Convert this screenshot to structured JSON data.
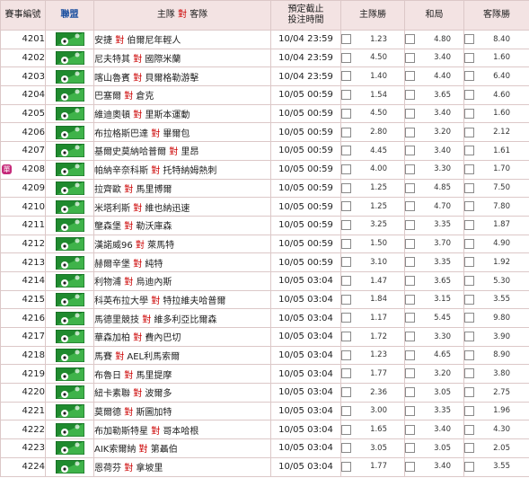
{
  "headers": {
    "num": "賽事編號",
    "league": "聯盟",
    "home": "主隊",
    "vs": "對",
    "away": "客隊",
    "time_line1": "預定截止",
    "time_line2": "投注時間",
    "home_win": "主隊勝",
    "draw": "和局",
    "away_win": "客隊勝"
  },
  "colors": {
    "header_bg": "#f3e3e3",
    "vs_red": "#cc0000",
    "league_blue": "#1a4fa0",
    "single_badge": "#c62a7a"
  },
  "rows": [
    {
      "num": "4201",
      "home": "安捷",
      "away": "伯爾尼年輕人",
      "time": "10/04 23:59",
      "h": "1.23",
      "d": "4.80",
      "a": "8.40"
    },
    {
      "num": "4202",
      "home": "尼夫特其",
      "away": "國際米蘭",
      "time": "10/04 23:59",
      "h": "4.50",
      "d": "3.40",
      "a": "1.60"
    },
    {
      "num": "4203",
      "home": "喀山魯賓",
      "away": "貝爾格勒游擊",
      "time": "10/04 23:59",
      "h": "1.40",
      "d": "4.40",
      "a": "6.40"
    },
    {
      "num": "4204",
      "home": "巴塞爾",
      "away": "倉克",
      "time": "10/05 00:59",
      "h": "1.54",
      "d": "3.65",
      "a": "4.60"
    },
    {
      "num": "4205",
      "home": "維迪奧頓",
      "away": "里斯本運動",
      "time": "10/05 00:59",
      "h": "4.50",
      "d": "3.40",
      "a": "1.60"
    },
    {
      "num": "4206",
      "home": "布拉格斯巴達",
      "away": "畢爾包",
      "time": "10/05 00:59",
      "h": "2.80",
      "d": "3.20",
      "a": "2.12"
    },
    {
      "num": "4207",
      "home": "基爾史莫納哈普爾",
      "away": "里昂",
      "time": "10/05 00:59",
      "h": "4.45",
      "d": "3.40",
      "a": "1.61"
    },
    {
      "num": "4208",
      "home": "帕納辛奈科斯",
      "away": "托特納姆熱刺",
      "time": "10/05 00:59",
      "h": "4.00",
      "d": "3.30",
      "a": "1.70",
      "single": "單"
    },
    {
      "num": "4209",
      "home": "拉齊歐",
      "away": "馬里博爾",
      "time": "10/05 00:59",
      "h": "1.25",
      "d": "4.85",
      "a": "7.50"
    },
    {
      "num": "4210",
      "home": "米塔利斯",
      "away": "維也納迅速",
      "time": "10/05 00:59",
      "h": "1.25",
      "d": "4.70",
      "a": "7.80"
    },
    {
      "num": "4211",
      "home": "壟森堡",
      "away": "勒沃庫森",
      "time": "10/05 00:59",
      "h": "3.25",
      "d": "3.35",
      "a": "1.87"
    },
    {
      "num": "4212",
      "home": "漢諾威96",
      "away": "萊馬特",
      "time": "10/05 00:59",
      "h": "1.50",
      "d": "3.70",
      "a": "4.90"
    },
    {
      "num": "4213",
      "home": "赫爾辛堡",
      "away": "純特",
      "time": "10/05 00:59",
      "h": "3.10",
      "d": "3.35",
      "a": "1.92"
    },
    {
      "num": "4214",
      "home": "利物浦",
      "away": "烏迪內斯",
      "time": "10/05 03:04",
      "h": "1.47",
      "d": "3.65",
      "a": "5.30"
    },
    {
      "num": "4215",
      "home": "科英布拉大學",
      "away": "特拉維夫哈普爾",
      "time": "10/05 03:04",
      "h": "1.84",
      "d": "3.15",
      "a": "3.55"
    },
    {
      "num": "4216",
      "home": "馬德里競技",
      "away": "維多利亞比爾森",
      "time": "10/05 03:04",
      "h": "1.17",
      "d": "5.45",
      "a": "9.80"
    },
    {
      "num": "4217",
      "home": "華森加柏",
      "away": "費內巴切",
      "time": "10/05 03:04",
      "h": "1.72",
      "d": "3.30",
      "a": "3.90"
    },
    {
      "num": "4218",
      "home": "馬賽",
      "away": "AEL利馬索爾",
      "time": "10/05 03:04",
      "h": "1.23",
      "d": "4.65",
      "a": "8.90"
    },
    {
      "num": "4219",
      "home": "布魯日",
      "away": "馬里提摩",
      "time": "10/05 03:04",
      "h": "1.77",
      "d": "3.20",
      "a": "3.80"
    },
    {
      "num": "4220",
      "home": "紐卡素聯",
      "away": "波爾多",
      "time": "10/05 03:04",
      "h": "2.36",
      "d": "3.05",
      "a": "2.75"
    },
    {
      "num": "4221",
      "home": "莫爾德",
      "away": "斯圖加特",
      "time": "10/05 03:04",
      "h": "3.00",
      "d": "3.35",
      "a": "1.96"
    },
    {
      "num": "4222",
      "home": "布加勒斯特星",
      "away": "哥本哈根",
      "time": "10/05 03:04",
      "h": "1.65",
      "d": "3.40",
      "a": "4.30"
    },
    {
      "num": "4223",
      "home": "AIK索爾納",
      "away": "第聶伯",
      "time": "10/05 03:04",
      "h": "3.05",
      "d": "3.05",
      "a": "2.05"
    },
    {
      "num": "4224",
      "home": "恩荷芬",
      "away": "拿坡里",
      "time": "10/05 03:04",
      "h": "1.77",
      "d": "3.40",
      "a": "3.55"
    }
  ]
}
